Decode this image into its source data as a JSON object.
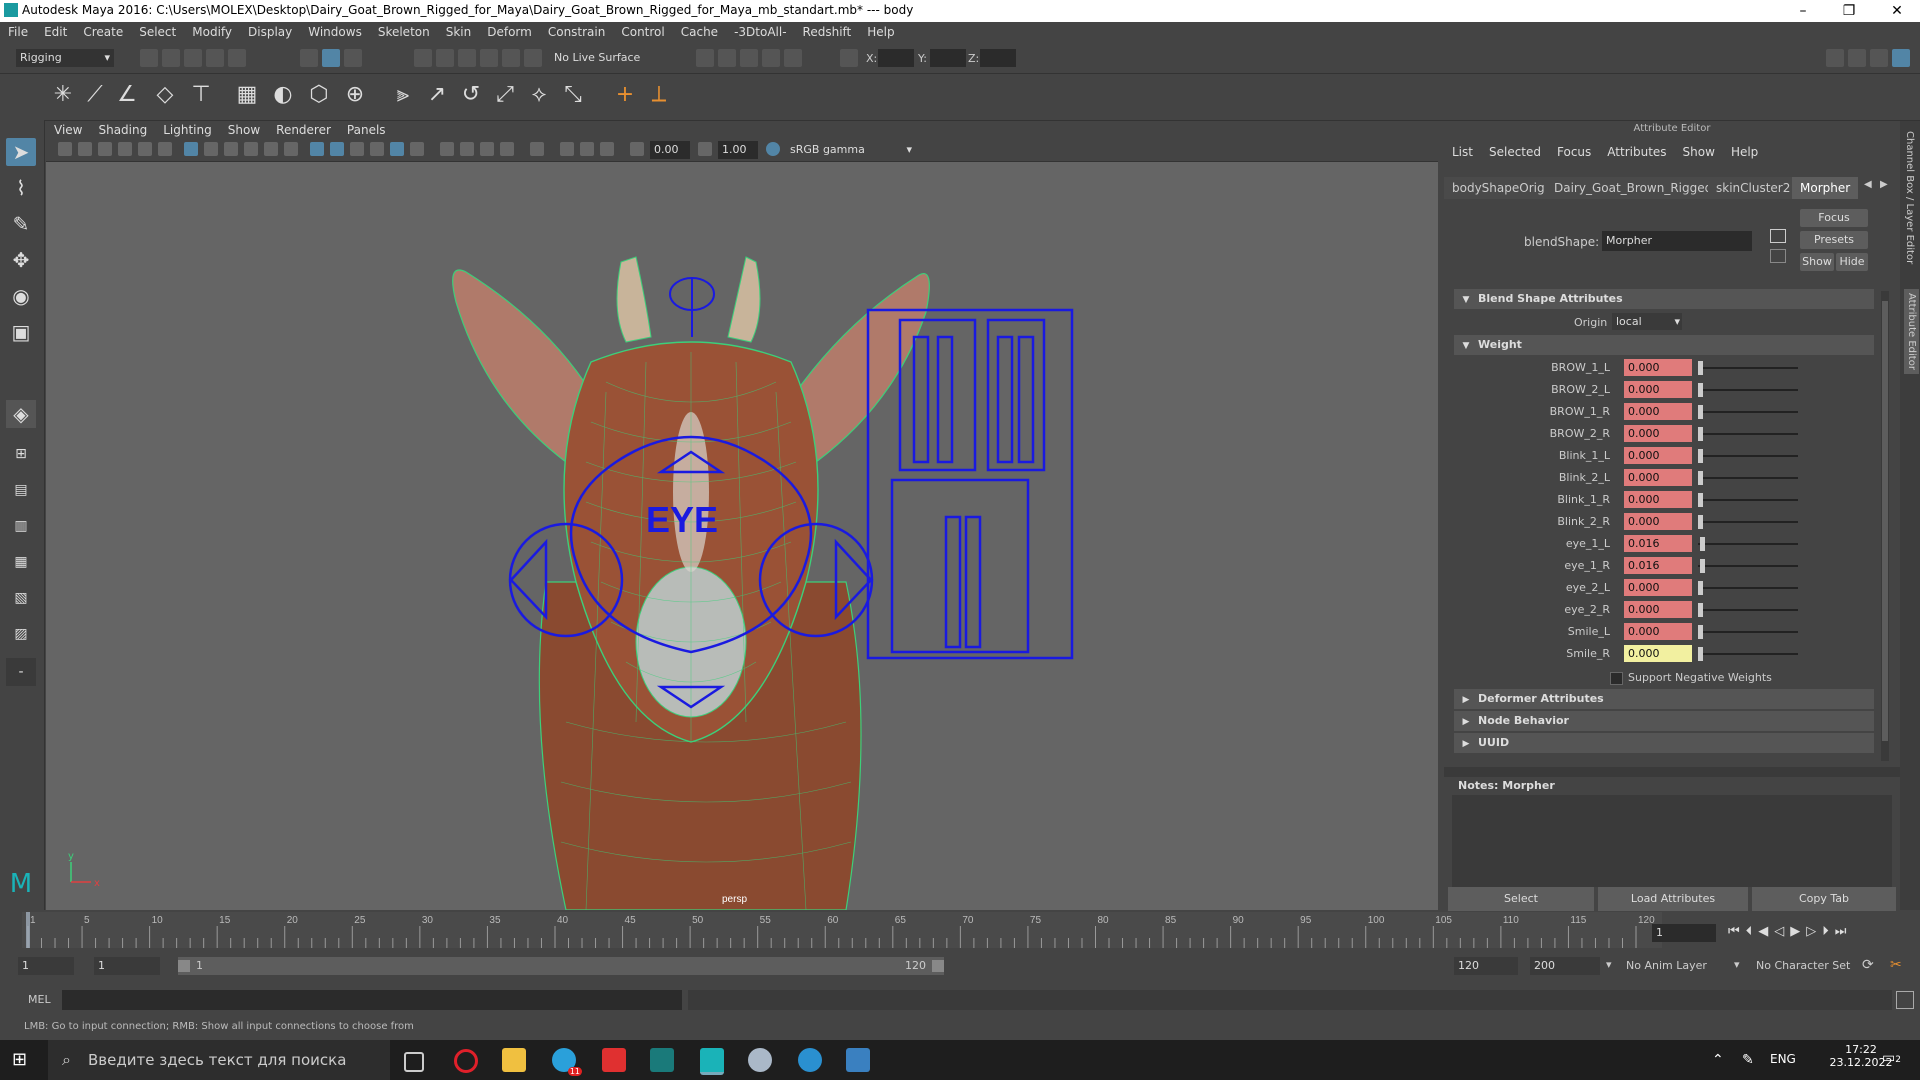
{
  "window": {
    "title": "Autodesk Maya 2016: C:\\Users\\MOLEX\\Desktop\\Dairy_Goat_Brown_Rigged_for_Maya\\Dairy_Goat_Brown_Rigged_for_Maya_mb_standart.mb*   ---   body",
    "minimize": "–",
    "restore": "❐",
    "close": "✕"
  },
  "menubar": [
    "File",
    "Edit",
    "Create",
    "Select",
    "Modify",
    "Display",
    "Windows",
    "Skeleton",
    "Skin",
    "Deform",
    "Constrain",
    "Control",
    "Cache",
    "-3DtoAll-",
    "Redshift",
    "Help"
  ],
  "statusline": {
    "menuset": "Rigging",
    "live_surface": "No Live Surface",
    "x_label": "X:",
    "y_label": "Y:",
    "z_label": "Z:"
  },
  "panel_menu": [
    "View",
    "Shading",
    "Lighting",
    "Show",
    "Renderer",
    "Panels"
  ],
  "viewport_toolbar": {
    "exposure": "0.00",
    "gamma": "1.00",
    "colorspace": "sRGB gamma"
  },
  "viewport": {
    "camera_label": "persp",
    "eye_label": "EYE",
    "axis_x": "x",
    "axis_y": "y"
  },
  "attribute_editor": {
    "title": "Attribute Editor",
    "menu": [
      "List",
      "Selected",
      "Focus",
      "Attributes",
      "Show",
      "Help"
    ],
    "tabs": [
      "bodyShapeOrig",
      "Dairy_Goat_Brown_Rigged",
      "skinCluster2",
      "Morpher"
    ],
    "active_tab": "Morpher",
    "node_type_label": "blendShape:",
    "node_name": "Morpher",
    "focus_btn": "Focus",
    "presets_btn": "Presets",
    "show_btn": "Show",
    "hide_btn": "Hide",
    "sections": {
      "blend_shape": "Blend Shape Attributes",
      "origin_label": "Origin",
      "origin_value": "local",
      "weight": "Weight",
      "support_negative": "Support Negative Weights",
      "deformer": "Deformer Attributes",
      "node_behavior": "Node Behavior",
      "uuid": "UUID"
    },
    "weights": [
      {
        "name": "BROW_1_L",
        "value": "0.000",
        "level": 0.0
      },
      {
        "name": "BROW_2_L",
        "value": "0.000",
        "level": 0.0
      },
      {
        "name": "BROW_1_R",
        "value": "0.000",
        "level": 0.0
      },
      {
        "name": "BROW_2_R",
        "value": "0.000",
        "level": 0.0
      },
      {
        "name": "Blink_1_L",
        "value": "0.000",
        "level": 0.0
      },
      {
        "name": "Blink_2_L",
        "value": "0.000",
        "level": 0.0
      },
      {
        "name": "Blink_1_R",
        "value": "0.000",
        "level": 0.0
      },
      {
        "name": "Blink_2_R",
        "value": "0.000",
        "level": 0.0
      },
      {
        "name": "eye_1_L",
        "value": "0.016",
        "level": 0.016
      },
      {
        "name": "eye_1_R",
        "value": "0.016",
        "level": 0.016
      },
      {
        "name": "eye_2_L",
        "value": "0.000",
        "level": 0.0
      },
      {
        "name": "eye_2_R",
        "value": "0.000",
        "level": 0.0
      },
      {
        "name": "Smile_L",
        "value": "0.000",
        "level": 0.0
      },
      {
        "name": "Smile_R",
        "value": "0.000",
        "level": 0.0
      }
    ],
    "notes_label": "Notes:  Morpher",
    "bottom": {
      "select": "Select",
      "load": "Load Attributes",
      "copy": "Copy Tab"
    }
  },
  "right_sidebar": {
    "channel_box": "Channel Box / Layer Editor",
    "attr_editor": "Attribute Editor"
  },
  "timeline": {
    "ticks": [
      "1",
      "5",
      "10",
      "15",
      "20",
      "25",
      "30",
      "35",
      "40",
      "45",
      "50",
      "55",
      "60",
      "65",
      "70",
      "75",
      "80",
      "85",
      "90",
      "95",
      "100",
      "105",
      "110",
      "115",
      "120"
    ],
    "current_frame": "1"
  },
  "range": {
    "start": "1",
    "playback_start": "1",
    "slider_start": "1",
    "slider_end": "120",
    "playback_end": "120",
    "end": "200",
    "anim_layer": "No Anim Layer",
    "char_set": "No Character Set"
  },
  "command_line": {
    "label": "MEL"
  },
  "help_line": "LMB: Go to input connection; RMB: Show all input connections to choose from",
  "taskbar": {
    "search_placeholder": "Введите здесь текст для поиска",
    "lang": "ENG",
    "time": "17:22",
    "date": "23.12.2022",
    "notif_count": "2",
    "telegram_badge": "11"
  }
}
